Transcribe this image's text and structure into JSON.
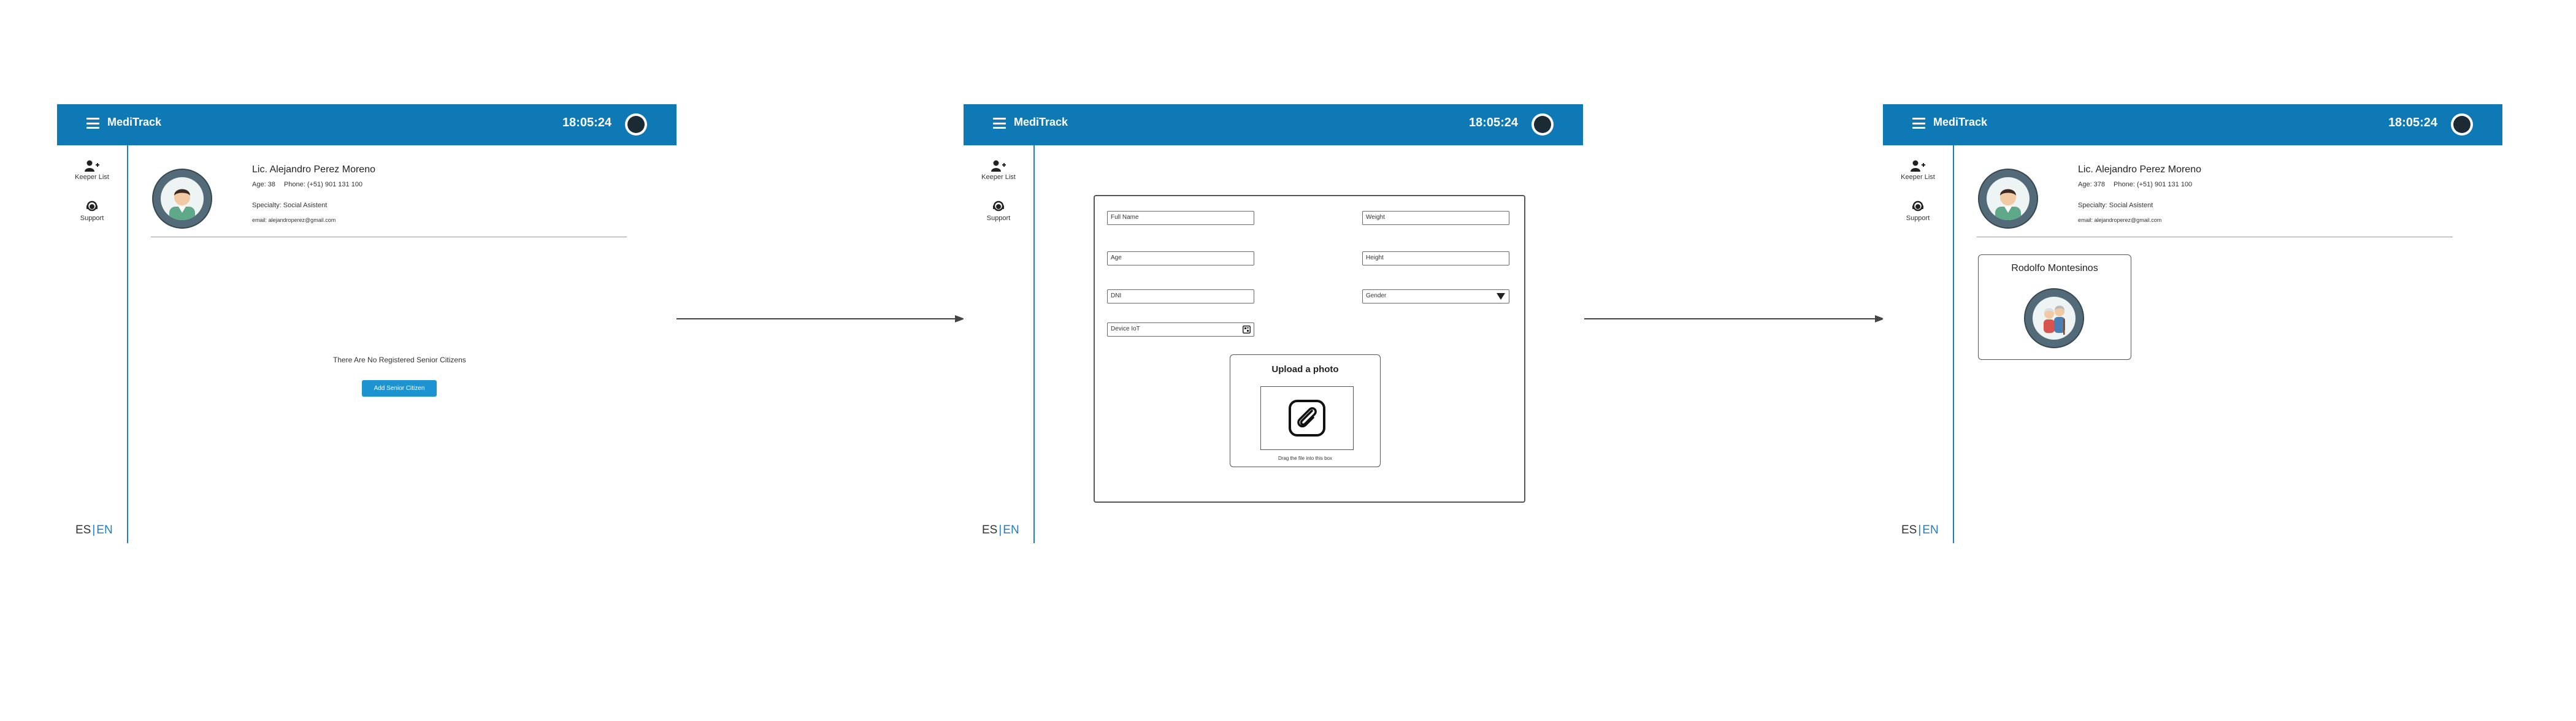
{
  "screens": [
    {
      "app_name": "MediTrack",
      "time": "18:05:24",
      "sidebar": {
        "keeper_list": "Keeper List",
        "support": "Support"
      },
      "lang": {
        "es": "ES",
        "sep": "|",
        "en": "EN"
      },
      "profile": {
        "name": "Lic. Alejandro Perez Moreno",
        "age": "Age: 38",
        "phone": "Phone: (+51) 901 131 100",
        "specialty": "Specialty: Social Asistent",
        "email": "email: alejandroperez@gmail.com"
      },
      "empty_message": "There Are No Registered Senior Citizens",
      "add_button": "Add Senior Citizen"
    },
    {
      "app_name": "MediTrack",
      "time": "18:05:24",
      "sidebar": {
        "keeper_list": "Keeper List",
        "support": "Support"
      },
      "lang": {
        "es": "ES",
        "sep": "|",
        "en": "EN"
      },
      "form": {
        "full_name": "Full Name",
        "weight": "Weight",
        "age": "Age",
        "height": "Height",
        "dni": "DNI",
        "gender": "Gender",
        "device_id": "Device IoT"
      },
      "upload": {
        "title": "Upload a photo",
        "hint": "Drag the file into this box"
      }
    },
    {
      "app_name": "MediTrack",
      "time": "18:05:24",
      "sidebar": {
        "keeper_list": "Keeper List",
        "support": "Support"
      },
      "lang": {
        "es": "ES",
        "sep": "|",
        "en": "EN"
      },
      "profile": {
        "name": "Lic. Alejandro Perez Moreno",
        "age": "Age: 378",
        "phone": "Phone: (+51) 901 131 100",
        "specialty": "Specialty: Social Asistent",
        "email": "email: alejandroperez@gmail.com"
      },
      "senior_card": {
        "name": "Rodolfo Montesinos"
      }
    }
  ],
  "colors": {
    "topbar": "#0f79b6",
    "accent": "#1f7dc1",
    "button": "#1d93d2"
  },
  "icons": [
    "menu-icon",
    "brand-logo-icon",
    "add-user-icon",
    "support-agent-icon",
    "paperclip-icon",
    "qr-scan-icon",
    "dropdown-caret-icon",
    "arrow-right-icon"
  ]
}
